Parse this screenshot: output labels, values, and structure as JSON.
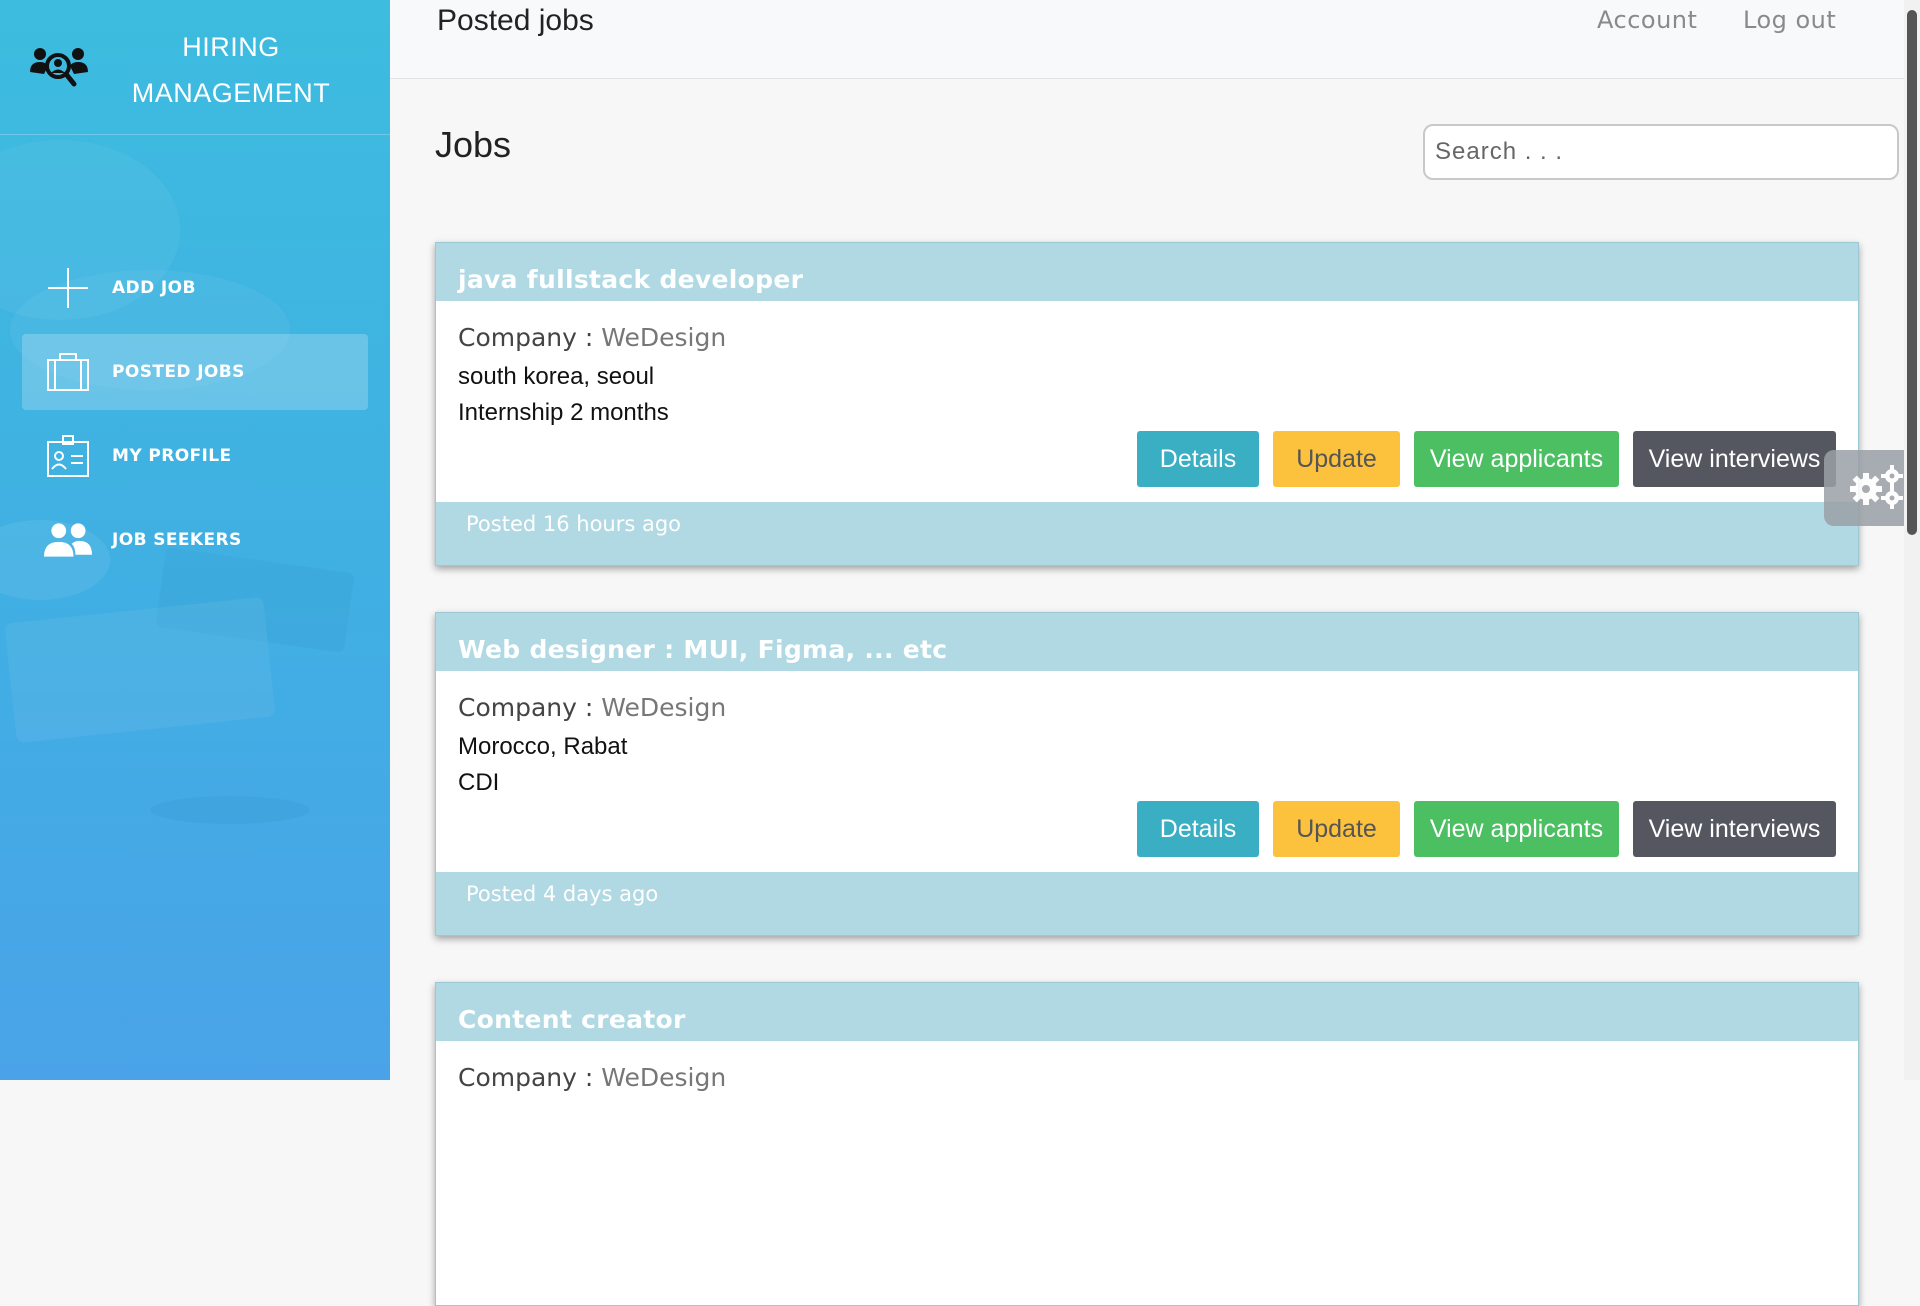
{
  "brand": {
    "title_line1": "HIRING",
    "title_line2": "MANAGEMENT",
    "icon": "team-search-icon"
  },
  "sidebar": {
    "items": [
      {
        "label": "ADD JOB",
        "icon": "plus-icon",
        "active": false
      },
      {
        "label": "POSTED JOBS",
        "icon": "briefcase-icon",
        "active": true
      },
      {
        "label": "MY PROFILE",
        "icon": "id-card-icon",
        "active": false
      },
      {
        "label": "JOB SEEKERS",
        "icon": "users-icon",
        "active": false
      }
    ]
  },
  "header": {
    "title": "Posted jobs",
    "account": "Account",
    "logout": "Log out"
  },
  "main": {
    "heading": "Jobs",
    "search_placeholder": "Search . . .",
    "company_label": "Company : ",
    "buttons": {
      "details": "Details",
      "update": "Update",
      "applicants": "View applicants",
      "interviews": "View interviews"
    },
    "jobs": [
      {
        "title": "java fullstack developer",
        "company": "WeDesign",
        "location": "south korea, seoul",
        "type": "Internship 2 months",
        "posted": "Posted 16 hours ago"
      },
      {
        "title": "Web designer : MUI, Figma, ... etc",
        "company": "WeDesign",
        "location": "Morocco, Rabat",
        "type": "CDI",
        "posted": "Posted 4 days ago"
      },
      {
        "title": "Content creator",
        "company": "WeDesign",
        "location": "",
        "type": "",
        "posted": ""
      }
    ]
  },
  "colors": {
    "sidebar_top": "#3dbcdf",
    "sidebar_bottom": "#4aa3e8",
    "card_header": "#b0d9e4",
    "details": "#3aaec3",
    "update": "#fcc23d",
    "applicants": "#4cbf63",
    "interviews": "#545760"
  },
  "settings_icon": "gears-icon"
}
